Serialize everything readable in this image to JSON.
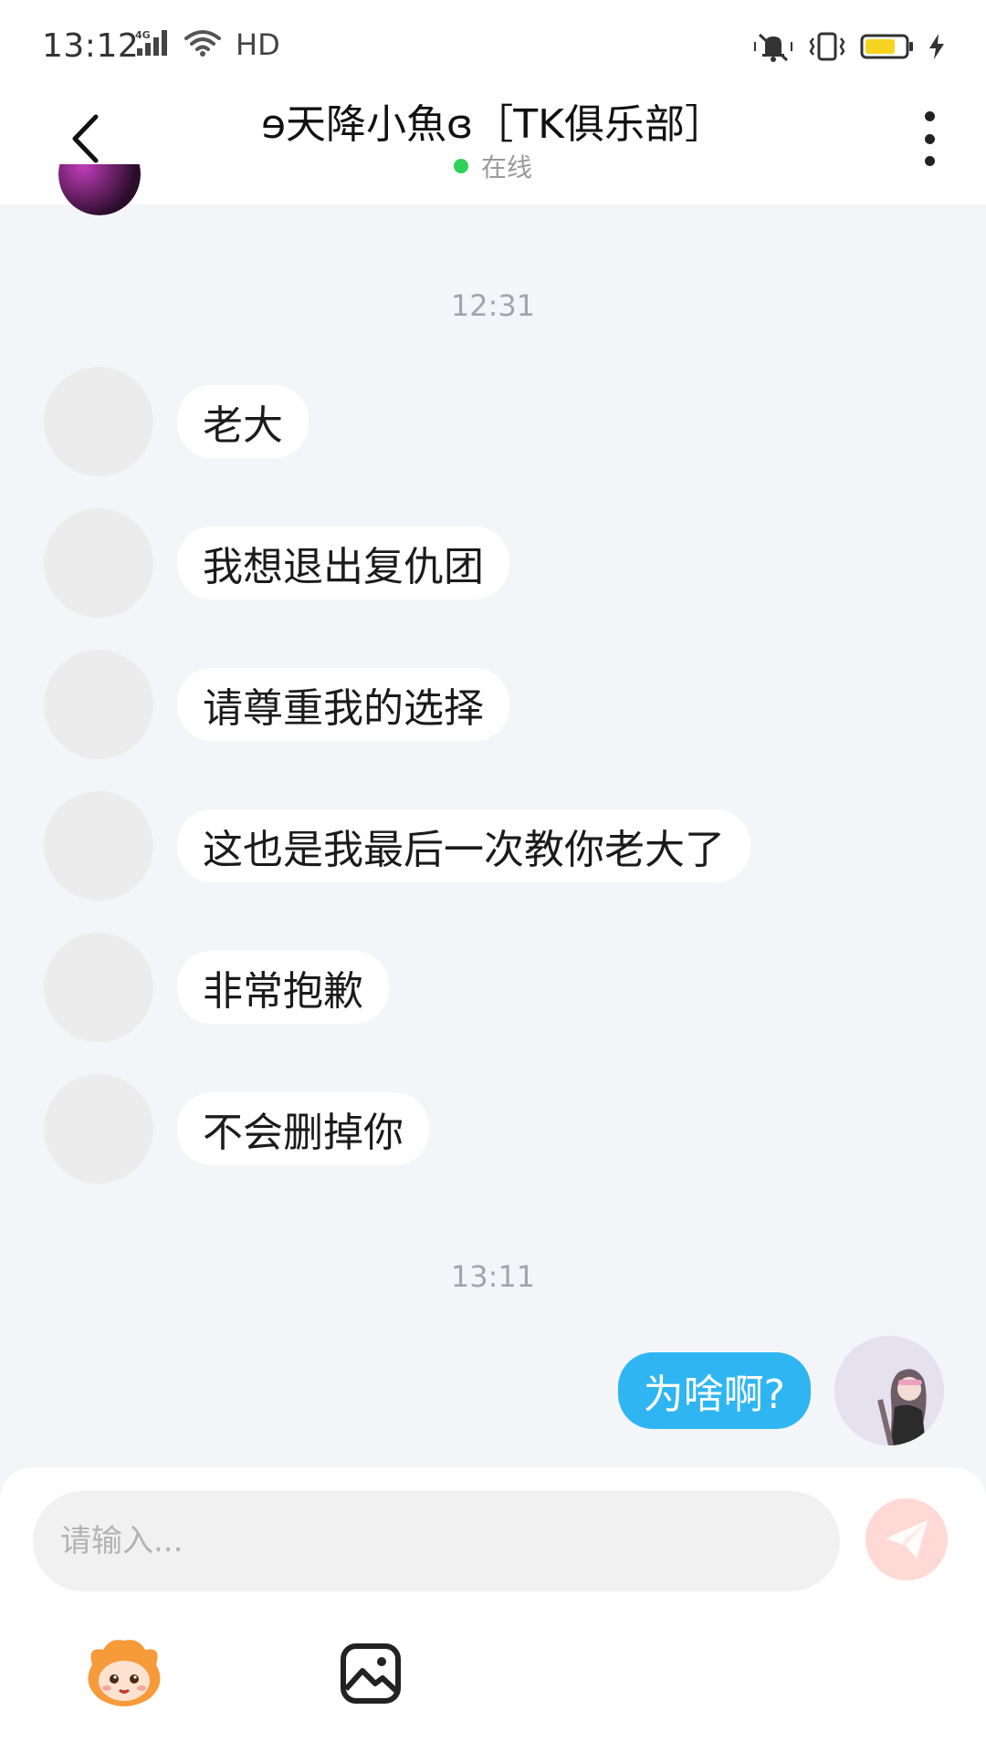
{
  "status_bar": {
    "time": "13:12",
    "network": "4G",
    "hd_label": "HD"
  },
  "header": {
    "title": "ɘ天降小魚ɞ［TK俱乐部］",
    "status": "在线",
    "status_color": "#2fd15a"
  },
  "chat": {
    "timestamp_1": "12:31",
    "incoming": [
      {
        "text": "老大"
      },
      {
        "text": "我想退出复仇团"
      },
      {
        "text": "请尊重我的选择"
      },
      {
        "text": "这也是我最后一次教你老大了"
      },
      {
        "text": "非常抱歉"
      },
      {
        "text": "不会删掉你"
      }
    ],
    "timestamp_2": "13:11",
    "outgoing": [
      {
        "text": "为啥啊?",
        "bubble_color": "#2fb5f2"
      }
    ]
  },
  "composer": {
    "placeholder": "请输入...",
    "send_icon": "paper-plane-icon",
    "tools": [
      "mascot-emoji-icon",
      "image-icon"
    ]
  }
}
